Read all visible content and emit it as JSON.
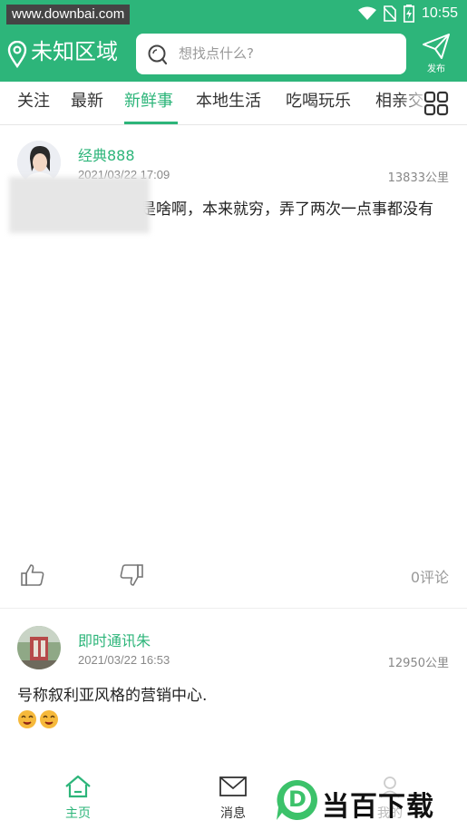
{
  "statusbar": {
    "watermark": "www.downbai.com",
    "time": "10:55"
  },
  "header": {
    "location": "未知区域",
    "search_placeholder": "想找点什么?",
    "publish_label": "发布"
  },
  "tabs": [
    {
      "label": "关注"
    },
    {
      "label": "最新"
    },
    {
      "label": "新鲜事"
    },
    {
      "label": "本地生活"
    },
    {
      "label": "吃喝玩乐"
    },
    {
      "label": "相亲交友"
    }
  ],
  "active_tab": "新鲜事",
  "posts": [
    {
      "username": "经典888",
      "time": "2021/03/22 17:09",
      "distance": "13833公里",
      "content": "杭州，这玩意到底是啥啊，本来就穷，弄了两次一点事都没有",
      "comments": "0评论"
    },
    {
      "username": "即时通讯朱",
      "time": "2021/03/22 16:53",
      "distance": "12950公里",
      "content": "号称叙利亚风格的营销中心."
    }
  ],
  "bottom_nav": [
    {
      "label": "主页"
    },
    {
      "label": "消息"
    },
    {
      "label": "我的"
    }
  ],
  "brand": {
    "text": "当百下载",
    "logo_letter": "D"
  },
  "colors": {
    "accent": "#2db57a",
    "text": "#222222",
    "muted": "#888888"
  }
}
